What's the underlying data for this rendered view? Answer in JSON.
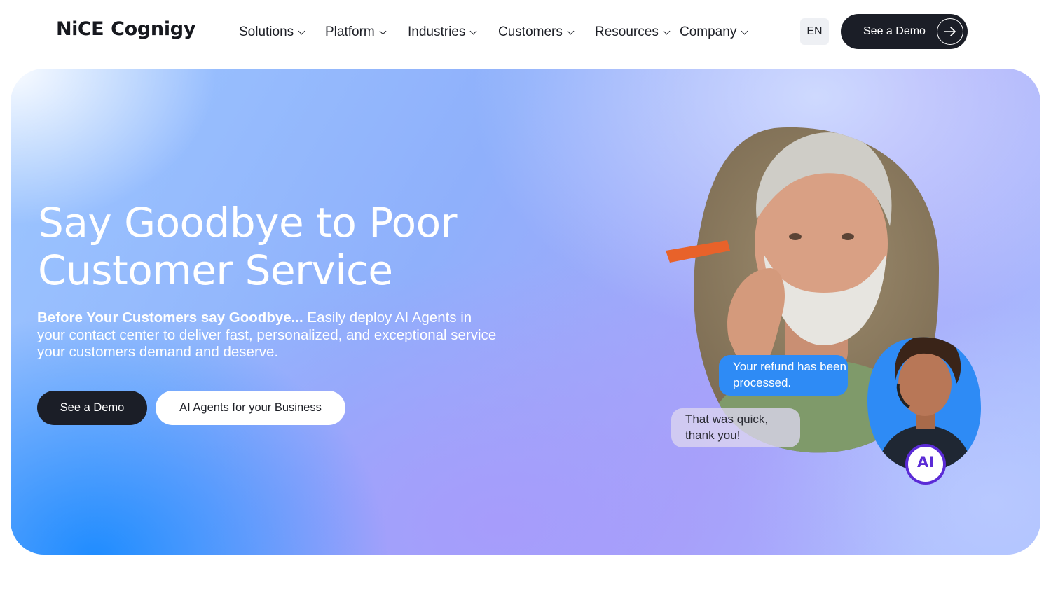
{
  "header": {
    "logo": {
      "brand": "NiCE",
      "product": "Cognigy"
    },
    "nav": [
      {
        "label": "Solutions"
      },
      {
        "label": "Platform"
      },
      {
        "label": "Industries"
      },
      {
        "label": "Customers"
      },
      {
        "label": "Resources"
      },
      {
        "label": "Company"
      }
    ],
    "language": "EN",
    "demo_button": "See a Demo"
  },
  "hero": {
    "title_line1": "Say Goodbye to Poor",
    "title_line2": "Customer Service",
    "subtitle_bold": "Before Your Customers say Goodbye...",
    "subtitle_text": " Easily deploy AI Agents in your contact center to deliver fast, personalized, and exceptional service your customers demand and deserve.",
    "primary_button": "See a Demo",
    "secondary_button": "AI Agents for your Business",
    "chat": {
      "ai_message": "Your refund has been processed.",
      "user_message": "That was quick, thank you!",
      "ai_badge": "AI"
    }
  },
  "colors": {
    "dark_button": "#1b1e27",
    "ai_bubble": "#2e8bf5",
    "ai_badge_ring": "#5b2bd6"
  },
  "icons": [
    "chevron-down-icon",
    "arrow-right-icon",
    "ai-badge-icon"
  ]
}
